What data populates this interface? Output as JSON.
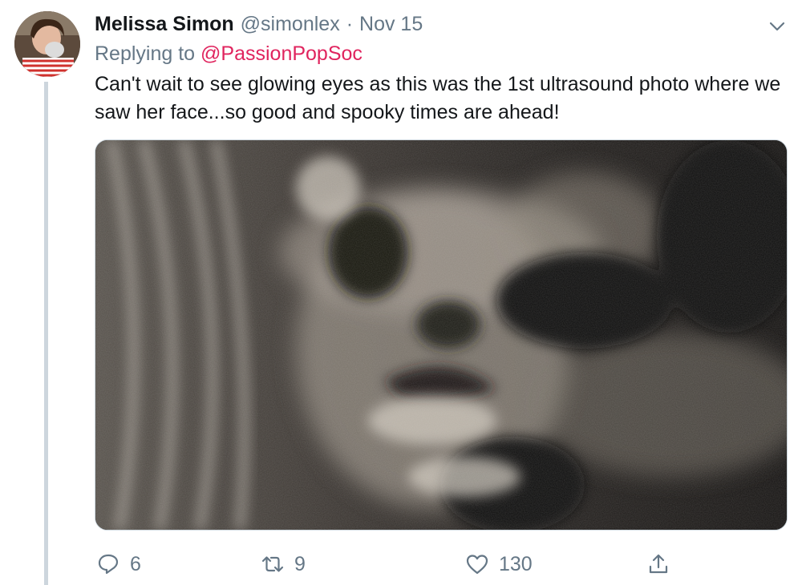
{
  "tweet": {
    "author": {
      "display_name": "Melissa Simon",
      "handle": "@simonlex",
      "avatar_icon": "profile-photo"
    },
    "separator": "·",
    "date": "Nov 15",
    "reply_to": {
      "prefix": "Replying to",
      "mention": "@PassionPopSoc"
    },
    "text": "Can't wait to see glowing eyes as this was the 1st ultrasound photo where we saw her face...so good and spooky times are ahead!",
    "media": {
      "kind": "photo",
      "alt": "Ultrasound photo of a baby's face"
    },
    "menu_icon": "chevron-down-icon",
    "actions": {
      "reply": {
        "icon": "reply-icon",
        "count": "6"
      },
      "retweet": {
        "icon": "retweet-icon",
        "count": "9"
      },
      "like": {
        "icon": "heart-icon",
        "count": "130"
      },
      "share": {
        "icon": "share-icon"
      }
    }
  },
  "colors": {
    "text_primary": "#14171a",
    "text_secondary": "#657786",
    "mention": "#e0245e",
    "thread_line": "#cdd6dd"
  }
}
